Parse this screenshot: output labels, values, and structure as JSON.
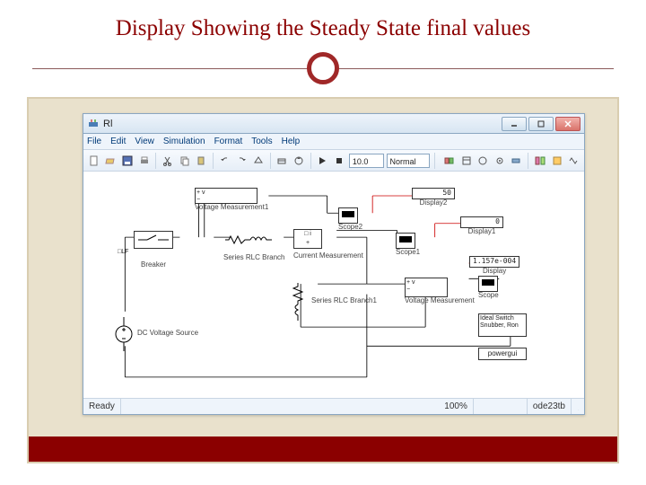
{
  "slide": {
    "title": "Display Showing the Steady State final values"
  },
  "window": {
    "title": "Rl",
    "menus": [
      "File",
      "Edit",
      "View",
      "Simulation",
      "Format",
      "Tools",
      "Help"
    ],
    "stop_time": "10.0",
    "mode": "Normal",
    "status": {
      "ready": "Ready",
      "zoom": "100%",
      "solver": "ode23tb"
    }
  },
  "blocks": {
    "voltage_meas1": "Voltage Measurement1",
    "breaker": "Breaker",
    "rlc": "Series RLC Branch",
    "current_meas": "Current Measurement",
    "rlc1": "Series RLC Branch1",
    "voltage_meas": "Voltage Measurement",
    "dc_source": "DC Voltage Source",
    "ideal_switch": "Ideal Switch",
    "snubber": "Snubber, Ron",
    "powergui": "powergui",
    "display2_label": "Display2",
    "display2_value": "50",
    "display1_label": "Display1",
    "display1_value": "0",
    "display_label": "Display",
    "display_value": "1.157e-004",
    "scope2": "Scope2",
    "scope1": "Scope1",
    "scope": "Scope"
  }
}
